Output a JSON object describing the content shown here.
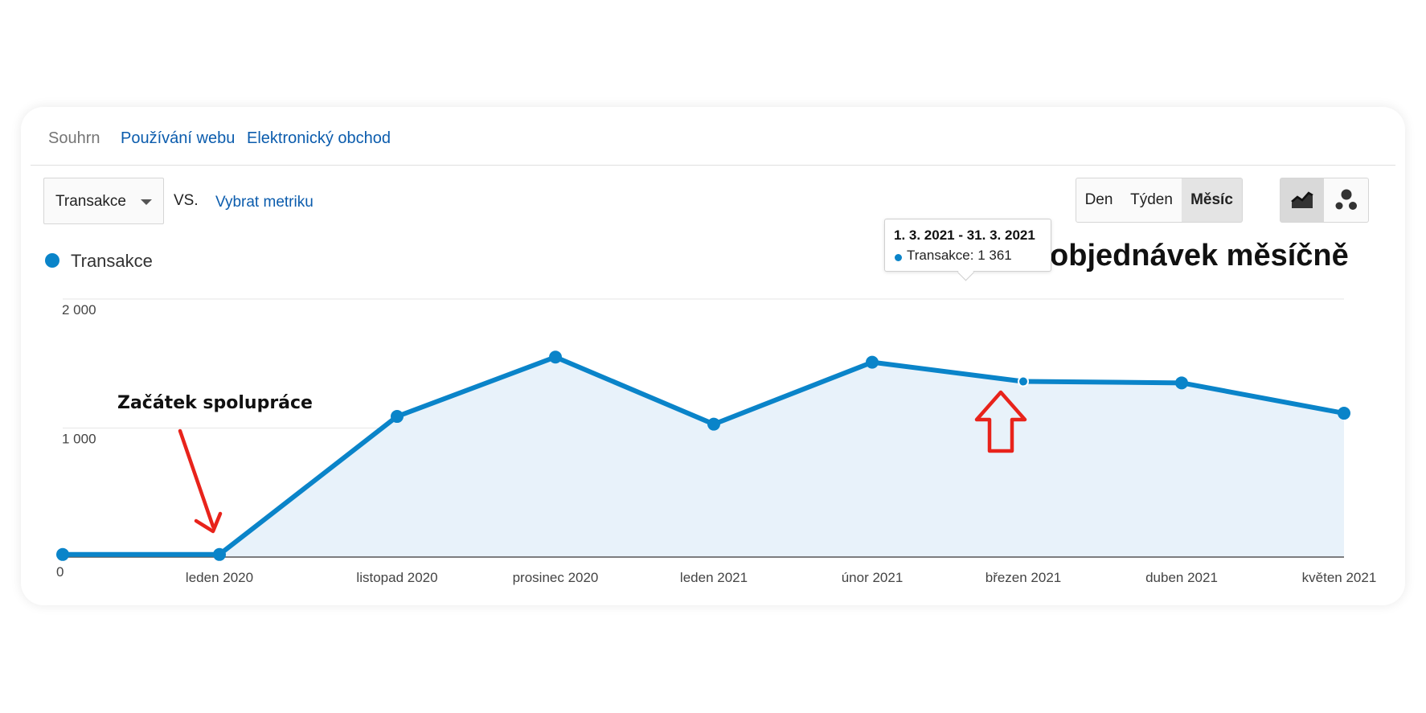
{
  "tabs": [
    {
      "label": "Souhrn"
    },
    {
      "label": "Používání webu"
    },
    {
      "label": "Elektronický obchod"
    }
  ],
  "controls": {
    "metric": "Transakce",
    "vs": "VS.",
    "pick_metric": "Vybrat metriku",
    "periods": [
      {
        "label": "Den"
      },
      {
        "label": "Týden"
      },
      {
        "label": "Měsíc",
        "selected": true
      }
    ],
    "views": [
      {
        "icon": "line-chart-icon",
        "selected": true
      },
      {
        "icon": "motion-chart-icon",
        "selected": false
      }
    ]
  },
  "legend": {
    "label": "Transakce",
    "color": "#0a84c9"
  },
  "headline": "Počet objednávek měsíčně",
  "annotation": {
    "text": "Začátek spolupráce"
  },
  "tooltip": {
    "range": "1. 3. 2021 - 31. 3. 2021",
    "series": "Transakce",
    "value": "1 361"
  },
  "chart_data": {
    "type": "area",
    "categories": [
      "",
      "leden 2020",
      "listopad 2020",
      "prosinec 2020",
      "leden 2021",
      "únor 2021",
      "březen 2021",
      "duben 2021",
      "květen 2021"
    ],
    "values": [
      20,
      20,
      1090,
      1550,
      1030,
      1510,
      1361,
      1350,
      1115
    ],
    "ylim": [
      0,
      2000
    ],
    "yticks": [
      {
        "value": 0,
        "label": "0"
      },
      {
        "value": 1000,
        "label": "1 000"
      },
      {
        "value": 2000,
        "label": "2 000"
      }
    ],
    "grid": true,
    "line_color": "#0a84c9",
    "fill_color": "#e8f2fa",
    "highlight_index": 6
  }
}
